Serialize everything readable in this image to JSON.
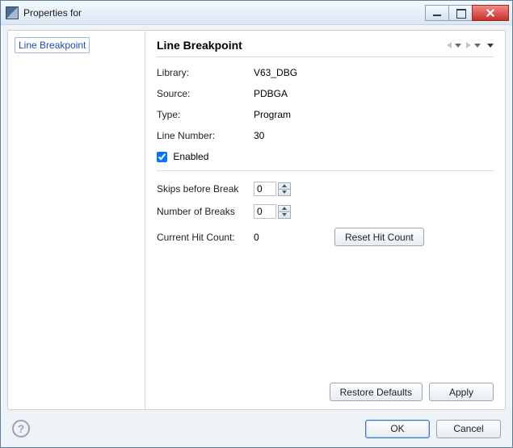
{
  "window": {
    "title": "Properties for"
  },
  "nav": {
    "items": [
      {
        "label": "Line Breakpoint"
      }
    ]
  },
  "panel": {
    "title": "Line Breakpoint",
    "library_label": "Library:",
    "library_value": "V63_DBG",
    "source_label": "Source:",
    "source_value": "PDBGA",
    "type_label": "Type:",
    "type_value": "Program",
    "line_label": "Line Number:",
    "line_value": "30",
    "enabled_label": "Enabled",
    "enabled_checked": true,
    "skips_label": "Skips before Break",
    "skips_value": "0",
    "breaks_label": "Number of Breaks",
    "breaks_value": "0",
    "hitcount_label": "Current Hit Count:",
    "hitcount_value": "0",
    "reset_button": "Reset Hit Count",
    "restore_defaults": "Restore Defaults",
    "apply": "Apply"
  },
  "footer": {
    "help_glyph": "?",
    "ok": "OK",
    "cancel": "Cancel"
  }
}
